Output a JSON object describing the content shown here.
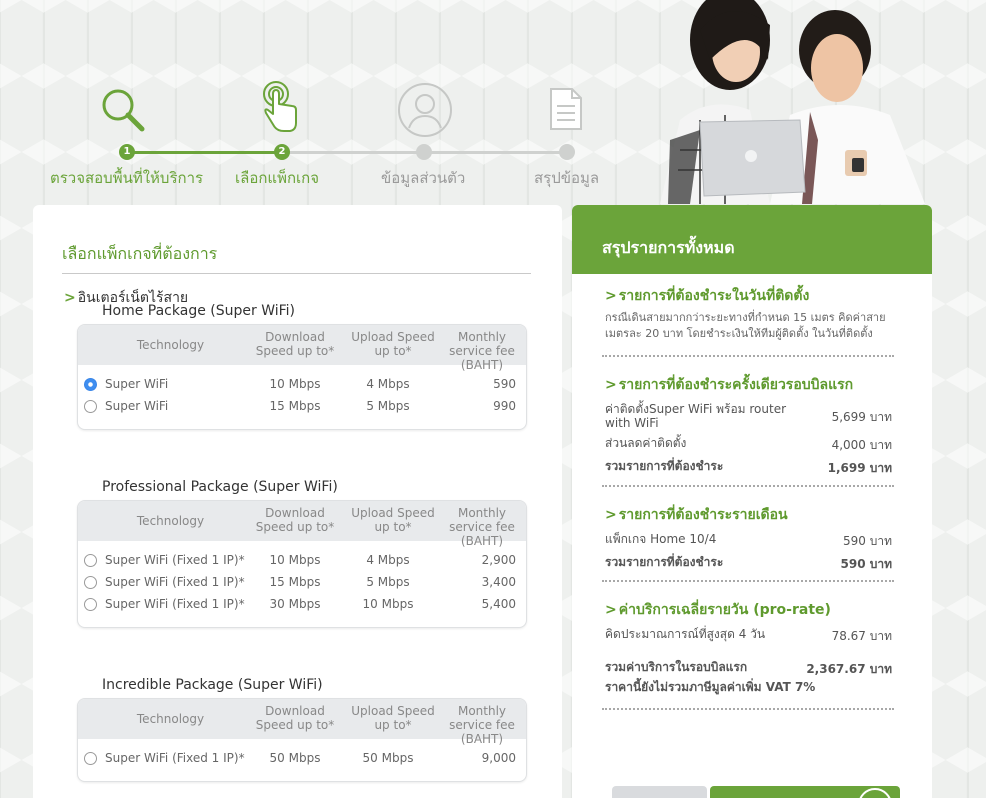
{
  "steps": [
    {
      "number": "1",
      "label": "ตรวจสอบพื้นที่ให้บริการ",
      "icon": "search-icon",
      "state": "done"
    },
    {
      "number": "2",
      "label": "เลือกแพ็กเกจ",
      "icon": "tap-hand-icon",
      "state": "active"
    },
    {
      "number": "",
      "label": "ข้อมูลส่วนตัว",
      "icon": "user-icon",
      "state": "inactive"
    },
    {
      "number": "",
      "label": "สรุปข้อมูล",
      "icon": "document-icon",
      "state": "inactive"
    }
  ],
  "colors": {
    "accent": "#6ba43a",
    "accent_dark": "#5f9a2e",
    "radio_checked": "#3f8ef0"
  },
  "left": {
    "title": "เลือกแพ็กเกจที่ต้องการ",
    "category": "อินเตอร์เน็ตไร้สาย",
    "columns": {
      "technology": "Technology",
      "download": "Download Speed up to*",
      "upload": "Upload Speed up to*",
      "fee": "Monthly service fee (BAHT)"
    },
    "packages": [
      {
        "name": "Home Package (Super WiFi)",
        "rows": [
          {
            "tech": "Super WiFi",
            "download": "10 Mbps",
            "upload": "4 Mbps",
            "fee": "590",
            "selected": true
          },
          {
            "tech": "Super WiFi",
            "download": "15 Mbps",
            "upload": "5 Mbps",
            "fee": "990",
            "selected": false
          }
        ]
      },
      {
        "name": "Professional Package (Super WiFi)",
        "rows": [
          {
            "tech": "Super WiFi (Fixed 1 IP)*",
            "download": "10 Mbps",
            "upload": "4 Mbps",
            "fee": "2,900",
            "selected": false
          },
          {
            "tech": "Super WiFi (Fixed 1 IP)*",
            "download": "15 Mbps",
            "upload": "5 Mbps",
            "fee": "3,400",
            "selected": false
          },
          {
            "tech": "Super WiFi (Fixed 1 IP)*",
            "download": "30 Mbps",
            "upload": "10 Mbps",
            "fee": "5,400",
            "selected": false
          }
        ]
      },
      {
        "name": "Incredible Package (Super WiFi)",
        "rows": [
          {
            "tech": "Super WiFi (Fixed 1 IP)*",
            "download": "50 Mbps",
            "upload": "50 Mbps",
            "fee": "9,000",
            "selected": false
          }
        ]
      }
    ]
  },
  "summary": {
    "title": "สรุปรายการทั้งหมด",
    "install_day": {
      "title": "รายการที่ต้องชำระในวันที่ติดตั้ง",
      "note": "กรณีเดินสายมากกว่าระยะทางที่กำหนด 15 เมตร คิดค่าสายเมตรละ 20 บาท โดยชำระเงินให้ทีมผู้ติดตั้ง ในวันที่ติดตั้ง"
    },
    "first_bill": {
      "title": "รายการที่ต้องชำระครั้งเดียวรอบบิลแรก",
      "items": [
        {
          "label": "ค่าติดตั้งSuper WiFi พร้อม router with WiFi",
          "value": "5,699 บาท"
        },
        {
          "label": "ส่วนลดค่าติดตั้ง",
          "value": "4,000 บาท"
        }
      ],
      "total_label": "รวมรายการที่ต้องชำระ",
      "total_value": "1,699 บาท"
    },
    "monthly": {
      "title": "รายการที่ต้องชำระรายเดือน",
      "item_label": "แพ็กเกจ Home 10/4",
      "item_value": "590 บาท",
      "total_label": "รวมรายการที่ต้องชำระ",
      "total_value": "590 บาท"
    },
    "prorate": {
      "title": "ค่าบริการเฉลี่ยรายวัน (pro-rate)",
      "item_label": "คิดประมาณการณ์ที่สูงสุด 4 วัน",
      "item_value": "78.67 บาท",
      "total_label": "รวมค่าบริการในรอบบิลแรก",
      "total_value": "2,367.67 บาท",
      "vat_note": "ราคานี้ยังไม่รวมภาษีมูลค่าเพิ่ม VAT 7%"
    }
  }
}
